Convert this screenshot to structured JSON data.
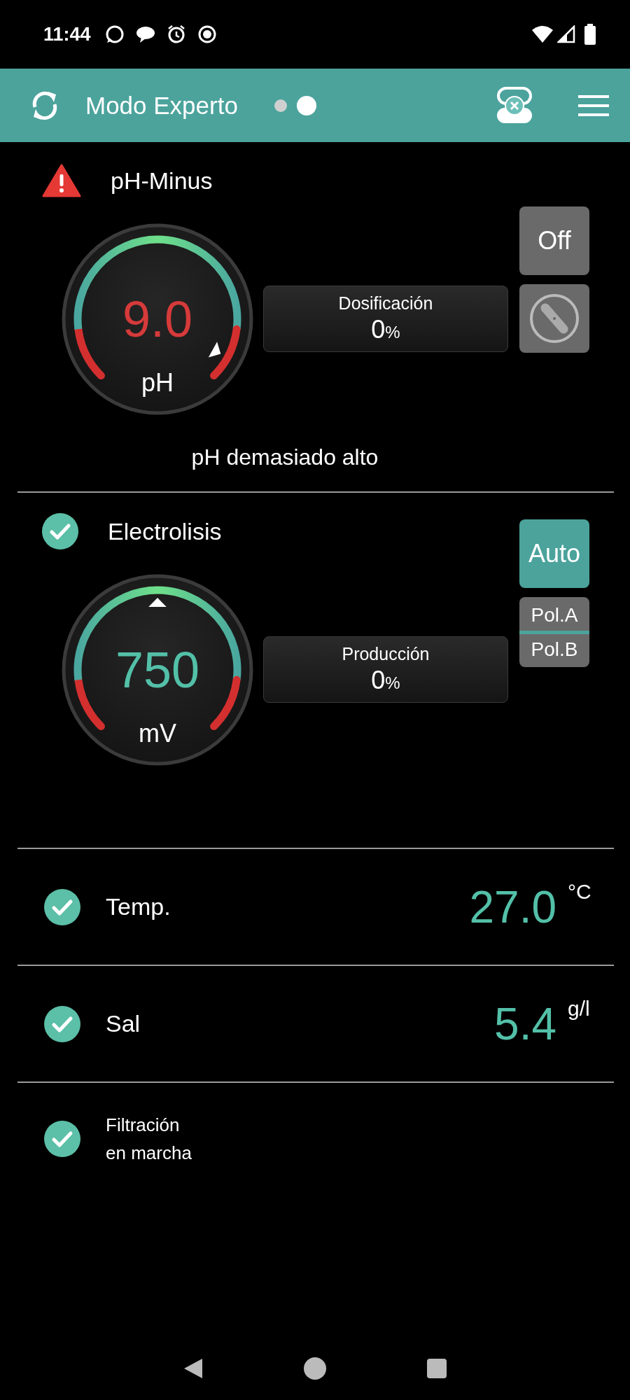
{
  "status_bar": {
    "time": "11:44"
  },
  "app_bar": {
    "title": "Modo Experto",
    "pages": [
      {
        "selected": false
      },
      {
        "selected": true
      }
    ]
  },
  "controllers": [
    {
      "kind": "pump",
      "name": "pH-Minus",
      "alarm": true,
      "gauge": {
        "value": "9.0",
        "unit": "pH"
      },
      "info": {
        "label": "Dosificación",
        "value": "0",
        "unit": "%"
      },
      "mode_button": {
        "label": "Off",
        "on": false
      },
      "message": "pH demasiado alto"
    },
    {
      "kind": "electrolysis",
      "name": "Electrolisis",
      "alarm": false,
      "gauge": {
        "value": "750",
        "unit": "mV"
      },
      "info": {
        "label": "Producción",
        "value": "0",
        "unit": "%"
      },
      "mode_button": {
        "label": "Auto",
        "on": true
      },
      "polarity": [
        "Pol.A",
        "Pol.B"
      ]
    }
  ],
  "readings": [
    {
      "alarm": false,
      "label": "Temp.",
      "value": "27.0",
      "unit": "°C"
    },
    {
      "alarm": false,
      "label": "Sal",
      "value": "5.4",
      "unit": "g/l"
    }
  ],
  "filtration": {
    "alarm": false,
    "lines": [
      "Filtración",
      "en marcha"
    ]
  }
}
